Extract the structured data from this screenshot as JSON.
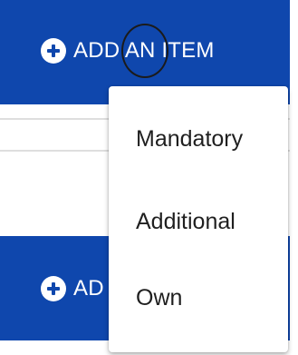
{
  "header": {
    "add_button_label": "ADD AN ITEM",
    "icon": "plus-circle-icon"
  },
  "second_section": {
    "add_button_label_visible": "AD",
    "icon": "plus-circle-icon"
  },
  "menu": {
    "items": [
      {
        "label": "Mandatory"
      },
      {
        "label": "Additional"
      },
      {
        "label": "Own"
      }
    ]
  },
  "colors": {
    "accent": "#0f47ad",
    "text": "#1f1f1f",
    "background": "#ffffff",
    "divider": "#dedede"
  }
}
